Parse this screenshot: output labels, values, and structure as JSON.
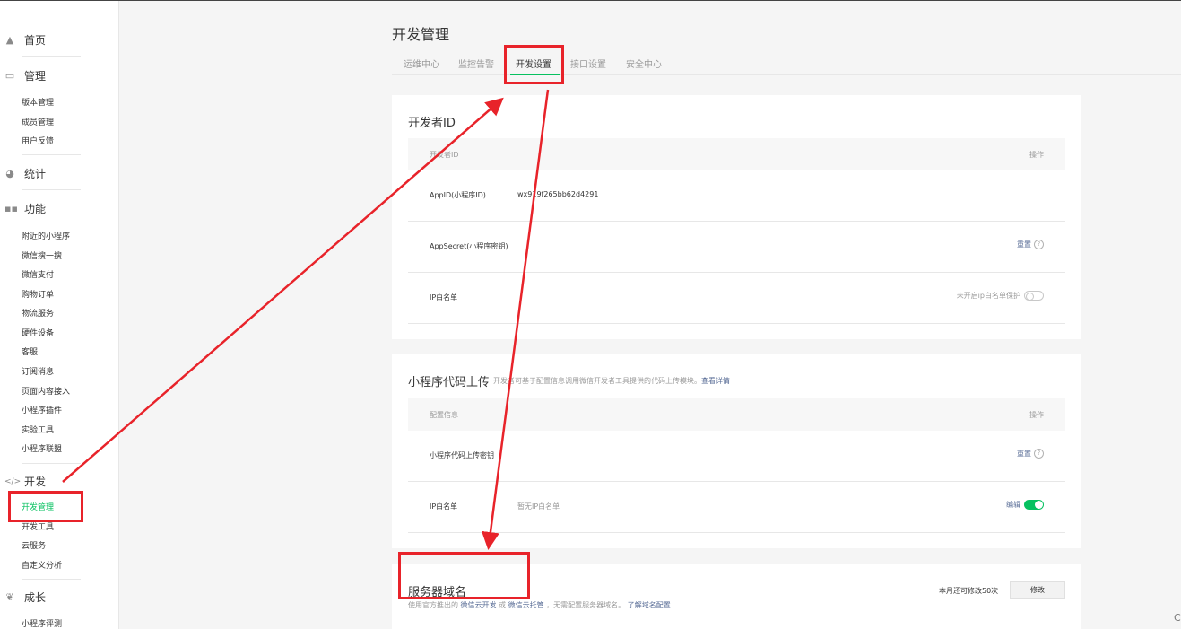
{
  "sidebar": {
    "home": "首页",
    "sections": [
      {
        "title": "管理",
        "icon": "inbox-icon",
        "items": [
          "版本管理",
          "成员管理",
          "用户反馈"
        ]
      },
      {
        "title": "统计",
        "icon": "pie-chart-icon",
        "items": []
      },
      {
        "title": "功能",
        "icon": "grid-icon",
        "items": [
          "附近的小程序",
          "微信搜一搜",
          "微信支付",
          "购物订单",
          "物流服务",
          "硬件设备",
          "客服",
          "订阅消息",
          "页面内容接入",
          "小程序插件",
          "实验工具",
          "小程序联盟"
        ]
      },
      {
        "title": "开发",
        "icon": "code-icon",
        "items": [
          "开发管理",
          "开发工具",
          "云服务",
          "自定义分析"
        ]
      },
      {
        "title": "成长",
        "icon": "sprout-icon",
        "items": [
          "小程序评测"
        ]
      }
    ],
    "active_item": "开发管理"
  },
  "header": {
    "title": "开发管理",
    "tabs": [
      "运维中心",
      "监控告警",
      "开发设置",
      "接口设置",
      "安全中心"
    ],
    "active_tab": "开发设置"
  },
  "developer_id": {
    "title": "开发者ID",
    "col_name": "开发者ID",
    "col_action": "操作",
    "appid_label": "AppID(小程序ID)",
    "appid_value": "wx919f265bb62d4291",
    "secret_label": "AppSecret(小程序密钥)",
    "secret_action": "重置",
    "ip_label": "IP白名单",
    "ip_status": "未开启ip白名单保护"
  },
  "code_upload": {
    "title": "小程序代码上传",
    "desc": "开发者可基于配置信息调用微信开发者工具提供的代码上传模块。",
    "desc_link": "查看详情",
    "col_name": "配置信息",
    "col_action": "操作",
    "key_label": "小程序代码上传密钥",
    "key_action": "重置",
    "ip_label": "IP白名单",
    "ip_value": "暂无IP白名单",
    "ip_action": "编辑"
  },
  "server_domain": {
    "title": "服务器域名",
    "desc_prefix": "使用官方推出的",
    "link1": "微信云开发",
    "or": "或",
    "link2": "微信云托管",
    "desc_suffix": "，无需配置服务器域名。",
    "link3": "了解域名配置",
    "quota": "本月还可修改50次",
    "modify": "修改"
  },
  "edge_char": "C",
  "colors": {
    "accent": "#07c160",
    "link": "#576b95",
    "annotation": "#e8232a"
  }
}
